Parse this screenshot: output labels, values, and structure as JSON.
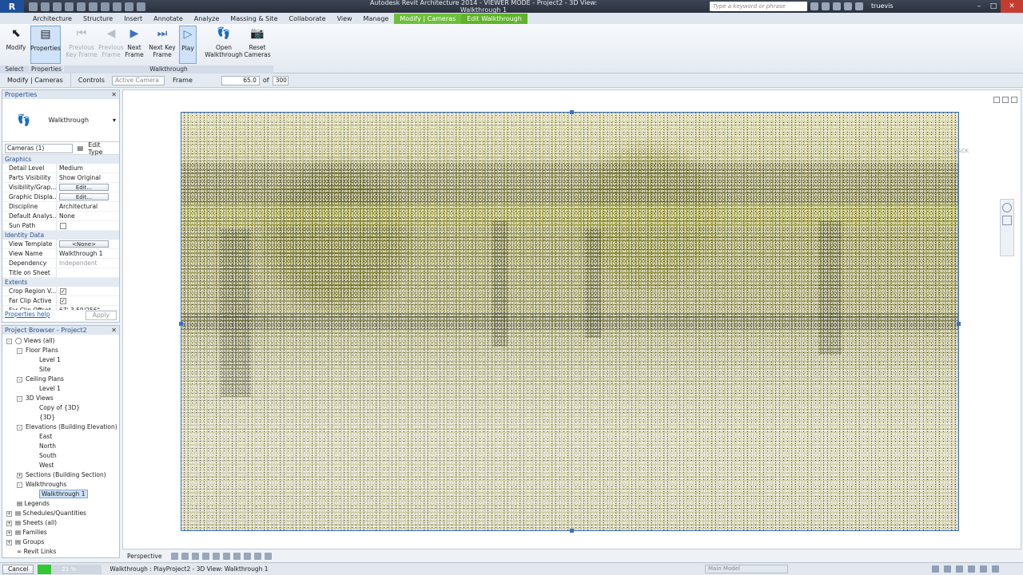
{
  "titlebar": {
    "app_logo": "R",
    "title": "Autodesk Revit Architecture 2014 - VIEWER MODE - Project2 - 3D View: Walkthrough 1",
    "search_placeholder": "Type a keyword or phrase",
    "user": "truevis"
  },
  "ribbon_tabs": [
    "Architecture",
    "Structure",
    "Insert",
    "Annotate",
    "Analyze",
    "Massing & Site",
    "Collaborate",
    "View",
    "Manage",
    "Modify | Cameras",
    "Edit Walkthrough"
  ],
  "ribbon": {
    "modify": "Modify",
    "properties": "Properties",
    "prev_key_frame": "Previous Key Frame",
    "prev_frame": "Previous Frame",
    "next_frame": "Next Frame",
    "next_key_frame": "Next Key Frame",
    "play": "Play",
    "open_walkthrough": "Open Walkthrough",
    "reset_cameras": "Reset Cameras",
    "panel_select": "Select",
    "panel_properties": "Properties",
    "panel_walkthrough": "Walkthrough"
  },
  "optbar": {
    "context": "Modify | Cameras",
    "controls_label": "Controls",
    "controls_value": "Active Camera",
    "frame_label": "Frame",
    "frame_value": "65.0",
    "of_label": "of",
    "total_frames": "300"
  },
  "properties": {
    "title": "Properties",
    "type_name": "Walkthrough",
    "instance_filter": "Cameras (1)",
    "edit_type": "Edit Type",
    "groups": {
      "graphics": "Graphics",
      "identity": "Identity Data",
      "extents": "Extents"
    },
    "rows": {
      "detail_level_k": "Detail Level",
      "detail_level_v": "Medium",
      "parts_vis_k": "Parts Visibility",
      "parts_vis_v": "Show Original",
      "vis_graph_k": "Visibility/Grap...",
      "vis_graph_v": "Edit...",
      "graphic_disp_k": "Graphic Displa...",
      "graphic_disp_v": "Edit...",
      "discipline_k": "Discipline",
      "discipline_v": "Architectural",
      "default_analysis_k": "Default Analys...",
      "default_analysis_v": "None",
      "sun_path_k": "Sun Path",
      "view_template_k": "View Template",
      "view_template_v": "<None>",
      "view_name_k": "View Name",
      "view_name_v": "Walkthrough 1",
      "dependency_k": "Dependency",
      "dependency_v": "Independent",
      "title_sheet_k": "Title on Sheet",
      "crop_region_k": "Crop Region V...",
      "far_clip_k": "Far Clip Active",
      "far_clip_offset_k": "Far Clip Offset",
      "far_clip_offset_v": "67' 3 59/256\""
    },
    "help_link": "Properties help",
    "apply": "Apply"
  },
  "browser": {
    "title": "Project Browser - Project2",
    "nodes": {
      "views": "Views (all)",
      "floor_plans": "Floor Plans",
      "fp_level1": "Level 1",
      "fp_site": "Site",
      "ceiling_plans": "Ceiling Plans",
      "cp_level1": "Level 1",
      "views_3d": "3D Views",
      "copy_3d": "Copy of {3D}",
      "view_3d": "{3D}",
      "elevations": "Elevations (Building Elevation)",
      "east": "East",
      "north": "North",
      "south": "South",
      "west": "West",
      "sections": "Sections (Building Section)",
      "walkthroughs": "Walkthroughs",
      "walkthrough1": "Walkthrough 1",
      "legends": "Legends",
      "schedules": "Schedules/Quantities",
      "sheets": "Sheets (all)",
      "families": "Families",
      "groups": "Groups",
      "revit_links": "Revit Links"
    }
  },
  "canvas": {
    "back_label": "BACK"
  },
  "viewbar": {
    "mode": "Perspective"
  },
  "status": {
    "cancel": "Cancel",
    "progress_pct": 21,
    "progress_label": "21 %",
    "message": "Walkthrough : PlayProject2 - 3D View: Walkthrough 1",
    "model": "Main Model"
  },
  "colors": {
    "contextual_tab": "#6dbf3a",
    "crop_border": "#3c70c8",
    "progress_fill": "#33c733"
  }
}
